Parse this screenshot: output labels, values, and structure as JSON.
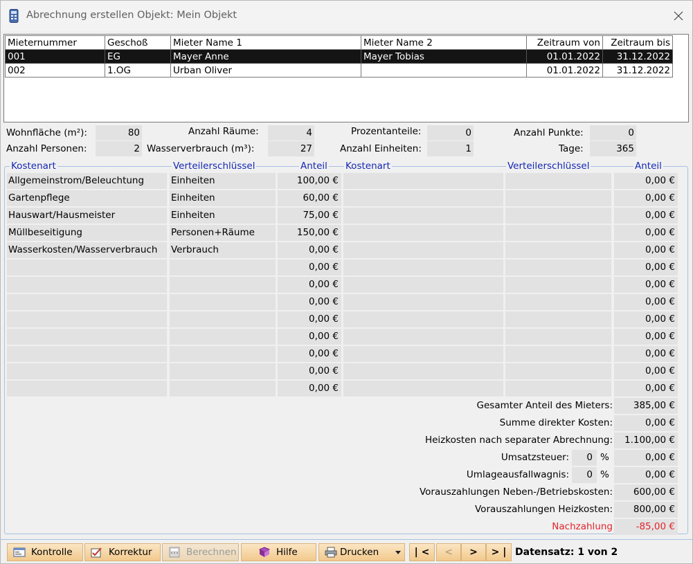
{
  "window": {
    "title": "Abrechnung erstellen Objekt: Mein Objekt"
  },
  "tenants_table": {
    "columns": [
      "Mieternummer",
      "Geschoß",
      "Mieter Name 1",
      "Mieter Name 2",
      "Zeitraum von",
      "Zeitraum bis"
    ],
    "rows": [
      [
        "001",
        "EG",
        "Mayer Anne",
        "Mayer Tobias",
        "01.01.2022",
        "31.12.2022"
      ],
      [
        "002",
        "1.OG",
        "Urban Oliver",
        "",
        "01.01.2022",
        "31.12.2022"
      ]
    ],
    "selected_row": 0
  },
  "stats": {
    "wohnflaeche": {
      "label": "Wohnfläche (m²):",
      "value": "80"
    },
    "anzahl_raeume": {
      "label": "Anzahl Räume:",
      "value": "4"
    },
    "prozentanteile": {
      "label": "Prozentanteile:",
      "value": "0"
    },
    "anzahl_punkte": {
      "label": "Anzahl Punkte:",
      "value": "0"
    },
    "anzahl_personen": {
      "label": "Anzahl Personen:",
      "value": "2"
    },
    "wasserverbrauch": {
      "label": "Wasserverbrauch (m³):",
      "value": "27"
    },
    "anzahl_einheiten": {
      "label": "Anzahl Einheiten:",
      "value": "1"
    },
    "tage": {
      "label": "Tage:",
      "value": "365"
    }
  },
  "costs": {
    "headers": {
      "kostenart": "Kostenart",
      "verteiler": "Verteilerschlüssel",
      "anteil": "Anteil"
    },
    "left": [
      {
        "kostenart": "Allgemeinstrom/Beleuchtung",
        "verteiler": "Einheiten",
        "anteil": "100,00 €"
      },
      {
        "kostenart": "Gartenpflege",
        "verteiler": "Einheiten",
        "anteil": "60,00 €"
      },
      {
        "kostenart": "Hauswart/Hausmeister",
        "verteiler": "Einheiten",
        "anteil": "75,00 €"
      },
      {
        "kostenart": "Müllbeseitigung",
        "verteiler": "Personen+Räume",
        "anteil": "150,00 €"
      },
      {
        "kostenart": "Wasserkosten/Wasserverbrauch",
        "verteiler": "Verbrauch",
        "anteil": "0,00 €"
      },
      {
        "kostenart": "",
        "verteiler": "",
        "anteil": "0,00 €"
      },
      {
        "kostenart": "",
        "verteiler": "",
        "anteil": "0,00 €"
      },
      {
        "kostenart": "",
        "verteiler": "",
        "anteil": "0,00 €"
      },
      {
        "kostenart": "",
        "verteiler": "",
        "anteil": "0,00 €"
      },
      {
        "kostenart": "",
        "verteiler": "",
        "anteil": "0,00 €"
      },
      {
        "kostenart": "",
        "verteiler": "",
        "anteil": "0,00 €"
      },
      {
        "kostenart": "",
        "verteiler": "",
        "anteil": "0,00 €"
      },
      {
        "kostenart": "",
        "verteiler": "",
        "anteil": "0,00 €"
      }
    ],
    "right": [
      {
        "kostenart": "",
        "verteiler": "",
        "anteil": "0,00 €"
      },
      {
        "kostenart": "",
        "verteiler": "",
        "anteil": "0,00 €"
      },
      {
        "kostenart": "",
        "verteiler": "",
        "anteil": "0,00 €"
      },
      {
        "kostenart": "",
        "verteiler": "",
        "anteil": "0,00 €"
      },
      {
        "kostenart": "",
        "verteiler": "",
        "anteil": "0,00 €"
      },
      {
        "kostenart": "",
        "verteiler": "",
        "anteil": "0,00 €"
      },
      {
        "kostenart": "",
        "verteiler": "",
        "anteil": "0,00 €"
      },
      {
        "kostenart": "",
        "verteiler": "",
        "anteil": "0,00 €"
      },
      {
        "kostenart": "",
        "verteiler": "",
        "anteil": "0,00 €"
      },
      {
        "kostenart": "",
        "verteiler": "",
        "anteil": "0,00 €"
      },
      {
        "kostenart": "",
        "verteiler": "",
        "anteil": "0,00 €"
      },
      {
        "kostenart": "",
        "verteiler": "",
        "anteil": "0,00 €"
      },
      {
        "kostenart": "",
        "verteiler": "",
        "anteil": "0,00 €"
      }
    ]
  },
  "summary": {
    "gesamter_anteil": {
      "label": "Gesamter Anteil des Mieters:",
      "value": "385,00 €"
    },
    "direkte_kosten": {
      "label": "Summe direkter Kosten:",
      "value": "0,00 €"
    },
    "heizkosten": {
      "label": "Heizkosten nach separater Abrechnung:",
      "value": "1.100,00 €"
    },
    "umsatzsteuer": {
      "label": "Umsatzsteuer:",
      "percent": "0",
      "unit": "%",
      "value": "0,00 €"
    },
    "umlageausfall": {
      "label": "Umlageausfallwagnis:",
      "percent": "0",
      "unit": "%",
      "value": "0,00 €"
    },
    "vz_neben": {
      "label": "Vorauszahlungen Neben-/Betriebskosten:",
      "value": "600,00 €"
    },
    "vz_heiz": {
      "label": "Vorauszahlungen Heizkosten:",
      "value": "800,00 €"
    },
    "nachzahlung": {
      "label": "Nachzahlung",
      "value": "-85,00 €",
      "color": "#e3242b"
    }
  },
  "toolbar": {
    "kontrolle": "Kontrolle",
    "korrektur": "Korrektur",
    "berechnen": "Berechnen",
    "hilfe": "Hilfe",
    "drucken": "Drucken",
    "first": "| <",
    "prev": "<",
    "next": ">",
    "last": "> |",
    "datensatz": "Datensatz: 1 von 2"
  },
  "icons": {
    "title": "calculator-icon",
    "kontrolle": "window-icon",
    "korrektur": "check-edit-icon",
    "berechnen": "calculator-icon",
    "hilfe": "help-book-icon",
    "drucken": "printer-icon",
    "drucken_menu": "caret-down-icon"
  },
  "colors": {
    "accent": "#1428b4",
    "negative": "#e3242b",
    "button": "#f2c98c"
  }
}
